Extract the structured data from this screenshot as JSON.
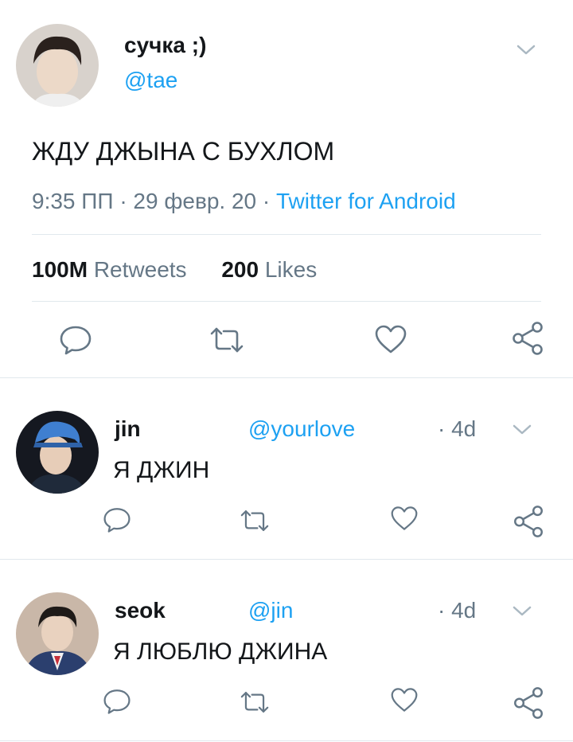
{
  "main_tweet": {
    "display_name": "сучка ;)",
    "handle": "@tae",
    "text": "ЖДУ ДЖЫНА С БУХЛОМ",
    "time": "9:35 ПП",
    "date": "29 февр. 20",
    "dot": "·",
    "source": "Twitter for Android",
    "retweets_count": "100M",
    "retweets_label": "Retweets",
    "likes_count": "200",
    "likes_label": "Likes"
  },
  "replies": [
    {
      "display_name": "jin",
      "handle": "@yourlove",
      "age": "· 4d",
      "text": "Я ДЖИН"
    },
    {
      "display_name": "seok",
      "handle": "@jin",
      "age": "· 4d",
      "text": "Я ЛЮБЛЮ ДЖИНА"
    }
  ],
  "icons": {
    "reply": "reply-icon",
    "retweet": "retweet-icon",
    "like": "like-icon",
    "share": "share-icon",
    "menu": "chevron-down-icon"
  },
  "colors": {
    "accent": "#1da1f2",
    "secondary_text": "#657786",
    "primary_text": "#14171a",
    "divider": "#e1e8ed"
  }
}
